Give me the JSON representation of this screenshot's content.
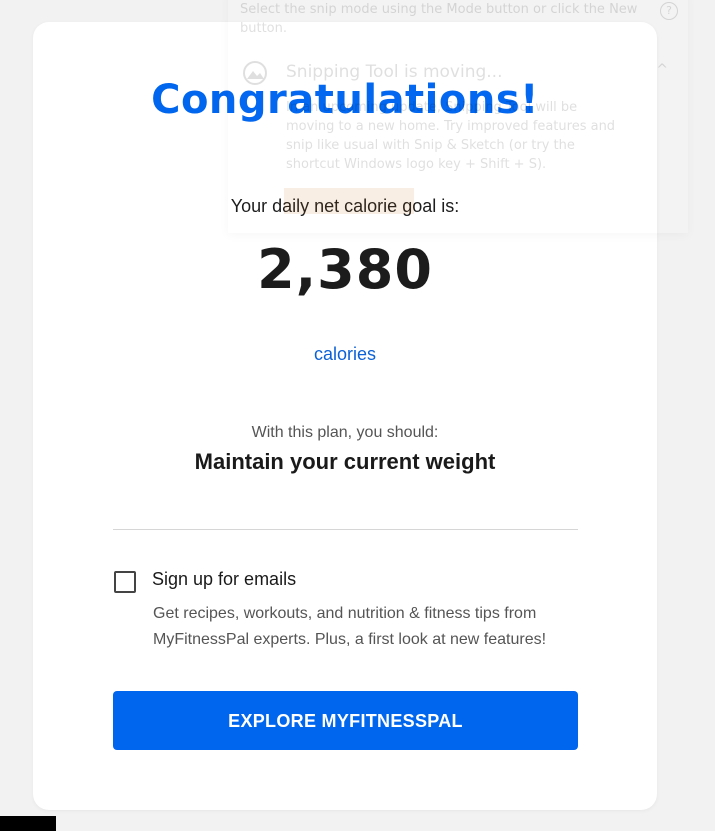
{
  "dialog": {
    "title": "Congratulations!",
    "goal_label": "Your daily net calorie goal is:",
    "goal_value": "2,380",
    "goal_unit": "calories",
    "plan_label": "With this plan, you should:",
    "plan_value": "Maintain your current weight",
    "email_opt_in": {
      "checked": false,
      "label": "Sign up for emails",
      "description": "Get recipes, workouts, and nutrition & fitness tips from MyFitnessPal experts. Plus, a first look at new features!"
    },
    "cta_label": "EXPLORE MYFITNESSPAL"
  },
  "notification": {
    "top_text": "Select the snip mode using the Mode button or click the New button.",
    "help_glyph": "?",
    "app_icon": "snipping-tool-icon",
    "title": "Snipping Tool is moving...",
    "body": "In an upcoming update, Snipping Tool will be moving to a new home. Try improved features and snip like usual with Snip & Sketch (or try the shortcut Windows logo key + Shift + S).",
    "collapse_glyph": "^"
  },
  "colors": {
    "accent": "#0066ee",
    "link": "#0b62d6",
    "text": "#1a1a1a",
    "muted": "#555555",
    "divider": "#d6d6d6",
    "background": "#f2f2f2"
  }
}
